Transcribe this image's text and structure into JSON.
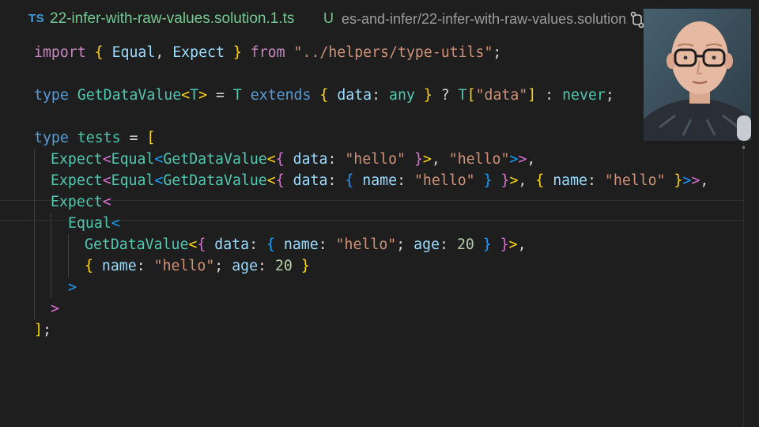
{
  "tab": {
    "language_badge": "TS",
    "filename": "22-infer-with-raw-values.solution.1.ts",
    "git_status": "U",
    "path": "es-and-infer/22-infer-with-raw-values.solution.1.ts",
    "action_icon": "git-compare-icon"
  },
  "code": {
    "line1": {
      "kw_import": "import",
      "b_open": "{",
      "t_equal": "Equal",
      "comma": ",",
      "t_expect": "Expect",
      "b_close": "}",
      "kw_from": "from",
      "path": "\"../helpers/type-utils\"",
      "semi": ";"
    },
    "line3": {
      "kw_type": "type",
      "name": "GetDataValue",
      "lt": "<",
      "param": "T",
      "gt": ">",
      "eq": "=",
      "t_ref": "T",
      "kw_extends": "extends",
      "b_open": "{",
      "prop": "data",
      "colon": ":",
      "kw_any": "any",
      "b_close": "}",
      "q": "?",
      "t_ref2": "T",
      "idx_open": "[",
      "idx_str": "\"data\"",
      "idx_close": "]",
      "colon2": ":",
      "kw_never": "never",
      "semi": ";"
    },
    "line5": {
      "kw_type": "type",
      "name": "tests",
      "eq": "=",
      "bracket": "["
    },
    "line6": {
      "t_expect": "Expect",
      "lt1": "<",
      "t_equal": "Equal",
      "lt2": "<",
      "t_gdv": "GetDataValue",
      "lt3": "<",
      "b_open": "{",
      "prop": "data",
      "colon": ":",
      "str1": "\"hello\"",
      "b_close": "}",
      "gt3": ">",
      "comma": ",",
      "str2": "\"hello\"",
      "gt2": ">",
      "gt1": ">",
      "comma2": ","
    },
    "line7": {
      "t_expect": "Expect",
      "lt1": "<",
      "t_equal": "Equal",
      "lt2": "<",
      "t_gdv": "GetDataValue",
      "lt3": "<",
      "b_open": "{",
      "prop": "data",
      "colon": ":",
      "ib_open": "{",
      "prop2": "name",
      "colon2": ":",
      "str1": "\"hello\"",
      "ib_close": "}",
      "b_close": "}",
      "gt3": ">",
      "comma": ",",
      "b2_open": "{",
      "prop3": "name",
      "colon3": ":",
      "str2": "\"hello\"",
      "b2_close": "}",
      "gt2": ">",
      "gt1": ">",
      "comma2": ","
    },
    "line8": {
      "t_expect": "Expect",
      "lt": "<"
    },
    "line9": {
      "t_equal": "Equal",
      "lt": "<"
    },
    "line10": {
      "t_gdv": "GetDataValue",
      "lt": "<",
      "b_open": "{",
      "prop": "data",
      "colon": ":",
      "ib_open": "{",
      "prop2": "name",
      "colon2": ":",
      "str": "\"hello\"",
      "semi": ";",
      "prop3": "age",
      "colon3": ":",
      "num": "20",
      "ib_close": "}",
      "b_close": "}",
      "gt": ">",
      "comma": ","
    },
    "line11": {
      "b_open": "{",
      "prop": "name",
      "colon": ":",
      "str": "\"hello\"",
      "semi": ";",
      "prop2": "age",
      "colon2": ":",
      "num": "20",
      "b_close": "}"
    },
    "line12": {
      "gt": ">"
    },
    "line13": {
      "gt": ">"
    },
    "line14": {
      "bracket": "]",
      "semi": ";"
    }
  },
  "colors": {
    "keyword": "#c586c0",
    "type": "#4ec9b0",
    "variable": "#9cdcfe",
    "string": "#ce9178",
    "number": "#b5cea8",
    "bracket_level1": "#ffd700",
    "bracket_level2": "#da70d6",
    "bracket_level3": "#179fff",
    "background": "#1e1e1e"
  },
  "webcam": {
    "description_icon": "presenter-webcam"
  }
}
